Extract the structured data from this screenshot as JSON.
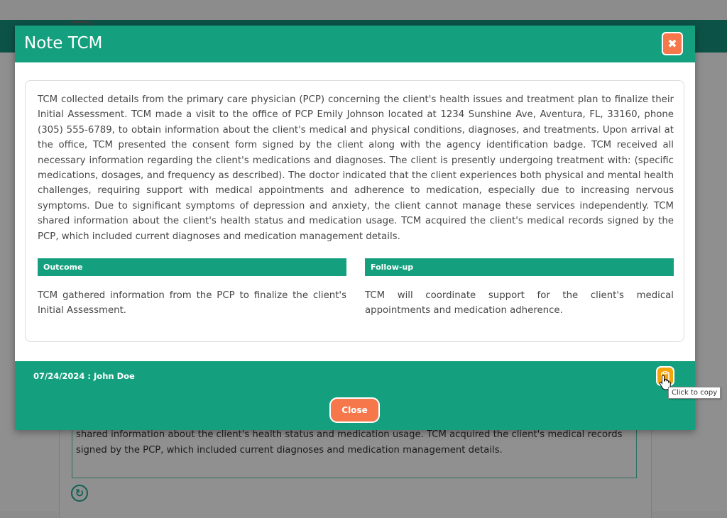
{
  "modal": {
    "title": "Note TCM",
    "close_x_icon": "close-icon",
    "note_text": "TCM collected details from the primary care physician (PCP) concerning the client's health issues and treatment plan to finalize their Initial Assessment. TCM made a visit to the office of PCP Emily Johnson located at 1234 Sunshine Ave, Aventura, FL, 33160, phone (305) 555-6789, to obtain information about the client's medical and physical conditions, diagnoses, and treatments. Upon arrival at the office, TCM presented the consent form signed by the client along with the agency identification badge. TCM received all necessary information regarding the client's medications and diagnoses. The client is presently undergoing treatment with: (specific medications, dosages, and frequency as described). The doctor indicated that the client experiences both physical and mental health challenges, requiring support with medical appointments and adherence to medication, especially due to increasing nervous symptoms. Due to significant symptoms of depression and anxiety, the client cannot manage these services independently. TCM shared information about the client's health status and medication usage. TCM acquired the client's medical records signed by the PCP, which included current diagnoses and medication management details.",
    "outcome": {
      "label": "Outcome",
      "text": "TCM gathered information from the PCP to finalize the client's Initial Assessment."
    },
    "followup": {
      "label": "Follow-up",
      "text": "TCM will coordinate support for the client's medical appointments and medication adherence."
    },
    "footer": {
      "meta": "07/24/2024 : John Doe",
      "copy_icon": "clipboard-icon",
      "copy_tooltip": "Click to copy",
      "close_label": "Close"
    }
  },
  "background": {
    "textarea_text": "shared information about the client's health status and medication usage. TCM acquired the client's medical records signed by the PCP, which included current diagnoses and medication management details.",
    "refresh_icon": "refresh-icon"
  },
  "colors": {
    "accent": "#14a07e",
    "orange": "#f6774a",
    "copy": "#f4a30b"
  }
}
